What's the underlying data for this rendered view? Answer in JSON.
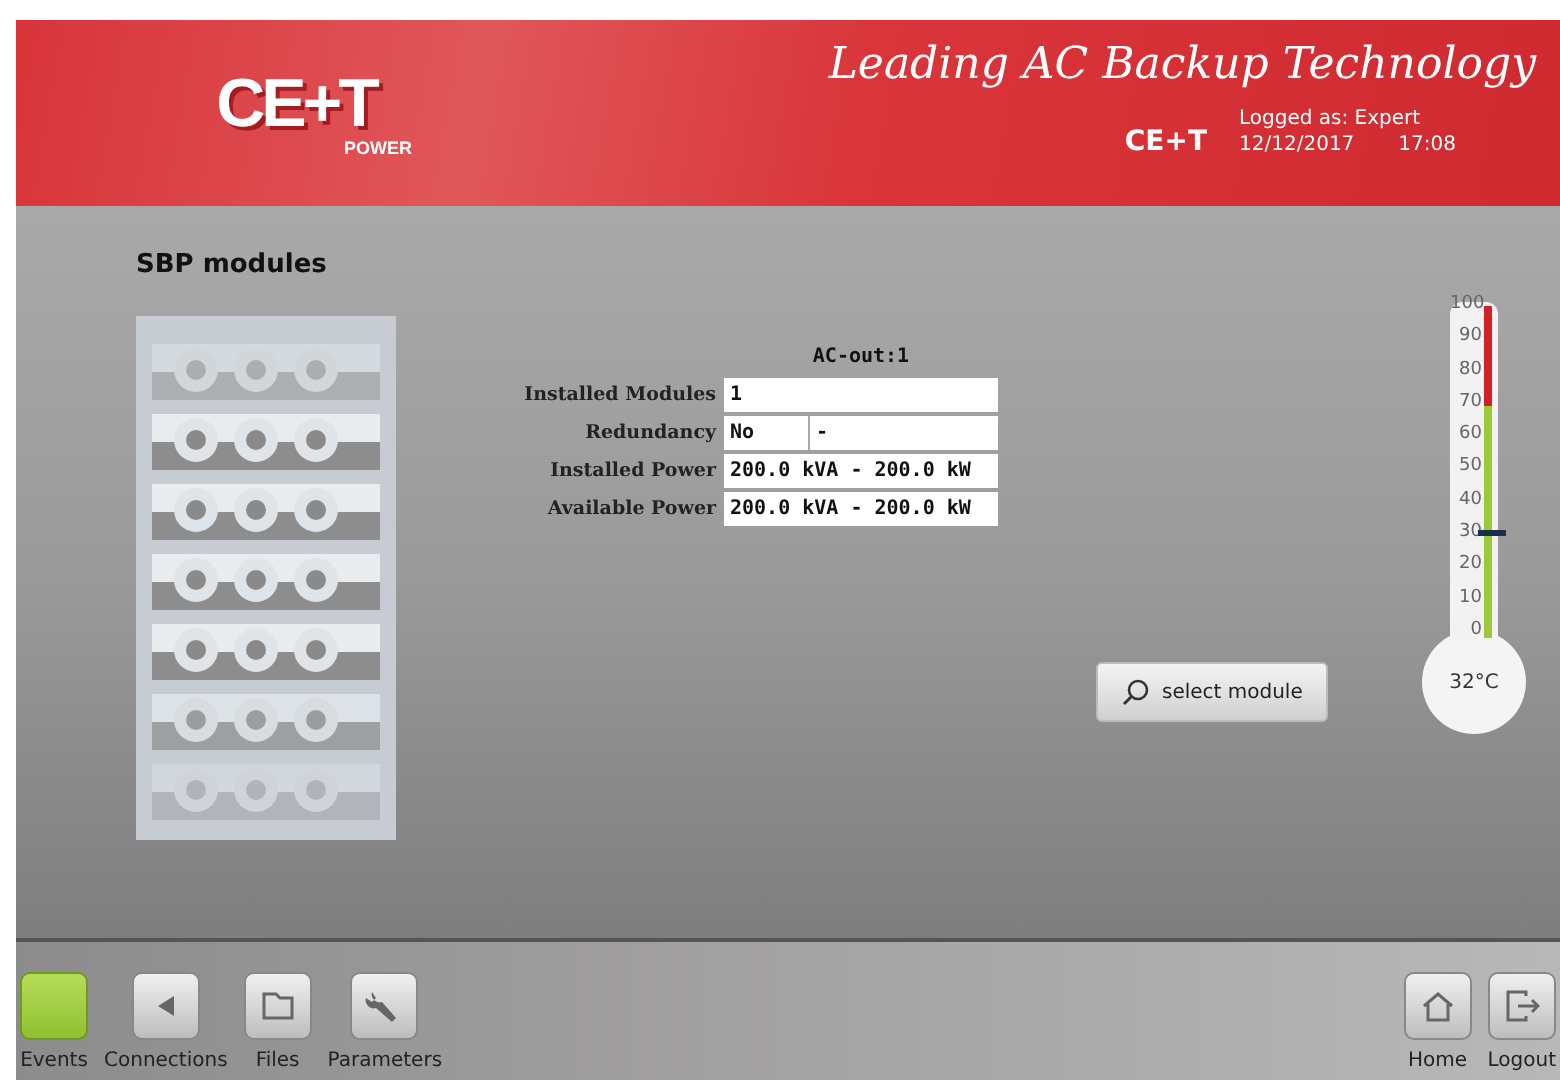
{
  "header": {
    "logo": {
      "text": "CE+T",
      "subtext": "POWER"
    },
    "tagline": "Leading AC Backup Technology",
    "brand": "CE+T",
    "user": "Logged as: Expert",
    "date": "12/12/2017",
    "time": "17:08"
  },
  "page": {
    "title": "SBP modules"
  },
  "modules": {
    "caption": "AC-out:1",
    "rows": [
      {
        "label": "Installed Modules",
        "values": [
          "1"
        ]
      },
      {
        "label": "Redundancy",
        "values": [
          "No",
          "-"
        ]
      },
      {
        "label": "Installed Power",
        "values": [
          "200.0 kVA - 200.0 kW"
        ]
      },
      {
        "label": "Available Power",
        "values": [
          "200.0 kVA - 200.0 kW"
        ]
      }
    ]
  },
  "select_button": {
    "label": "select module"
  },
  "thermometer": {
    "ticks": [
      "100",
      "90",
      "80",
      "70",
      "60",
      "50",
      "40",
      "30",
      "20",
      "10",
      "0"
    ],
    "level": 0.32,
    "reading": "32°C"
  },
  "footer": {
    "left": [
      {
        "kind": "events",
        "label": "Events",
        "highlighted": true
      },
      {
        "kind": "connections",
        "label": "Connections",
        "highlighted": false
      },
      {
        "kind": "files",
        "label": "Files",
        "highlighted": false
      },
      {
        "kind": "parameters",
        "label": "Parameters",
        "highlighted": false
      }
    ],
    "right": [
      {
        "kind": "home",
        "label": "Home",
        "highlighted": false
      },
      {
        "kind": "logout",
        "label": "Logout",
        "highlighted": false
      }
    ]
  }
}
